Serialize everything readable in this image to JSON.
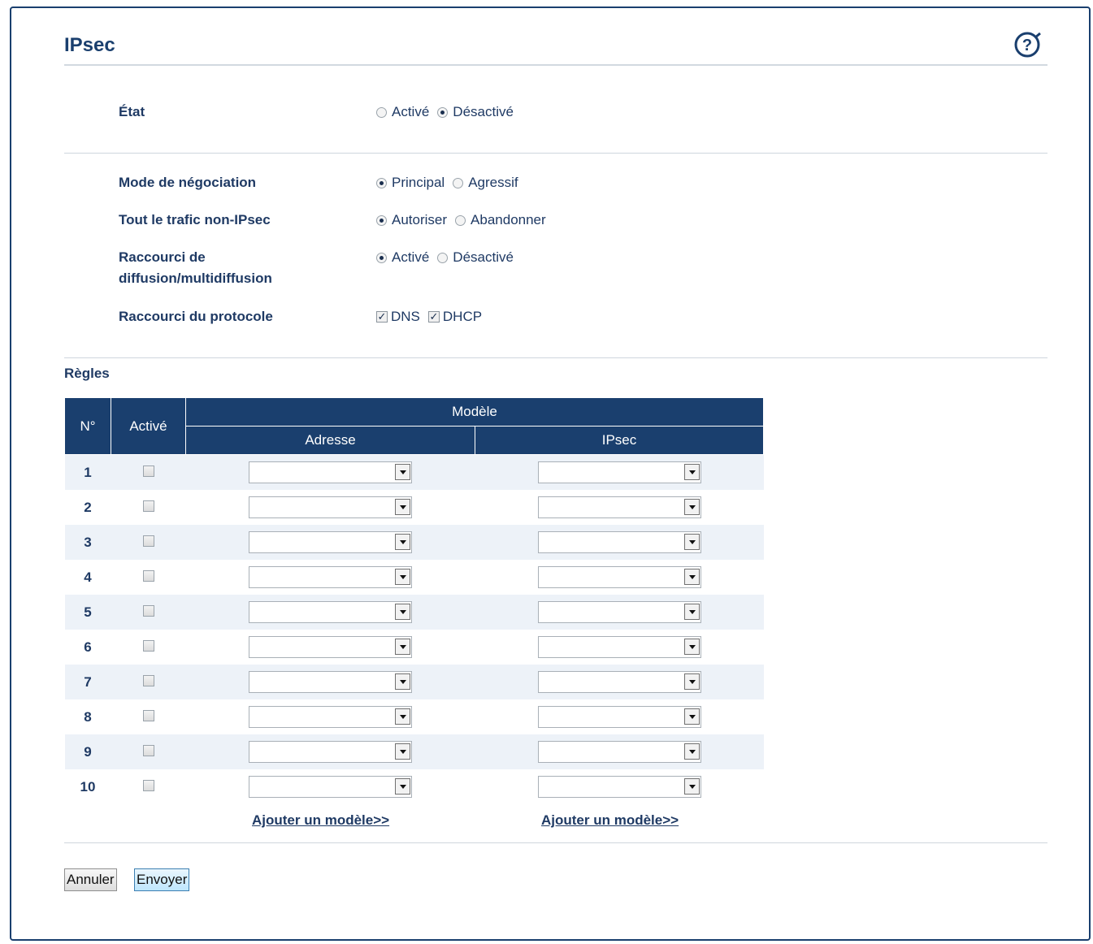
{
  "page": {
    "title": "IPsec"
  },
  "icons": {
    "help": "help-icon"
  },
  "status": {
    "label": "État",
    "options": [
      {
        "label": "Activé",
        "selected": false
      },
      {
        "label": "Désactivé",
        "selected": true
      }
    ]
  },
  "negotiation": {
    "label": "Mode de négociation",
    "options": [
      {
        "label": "Principal",
        "selected": true
      },
      {
        "label": "Agressif",
        "selected": false
      }
    ]
  },
  "traffic": {
    "label": "Tout le trafic non-IPsec",
    "options": [
      {
        "label": "Autoriser",
        "selected": true
      },
      {
        "label": "Abandonner",
        "selected": false
      }
    ]
  },
  "broadcast": {
    "label_line1": "Raccourci de",
    "label_line2": "diffusion/multidiffusion",
    "options": [
      {
        "label": "Activé",
        "selected": true
      },
      {
        "label": "Désactivé",
        "selected": false
      }
    ]
  },
  "protocol": {
    "label": "Raccourci du protocole",
    "options": [
      {
        "label": "DNS",
        "checked": true
      },
      {
        "label": "DHCP",
        "checked": true
      }
    ]
  },
  "rules": {
    "title": "Règles",
    "headers": {
      "num": "N°",
      "enabled": "Activé",
      "template": "Modèle",
      "address": "Adresse",
      "ipsec": "IPsec"
    },
    "rows": [
      {
        "num": "1",
        "enabled": false,
        "address": "",
        "ipsec": ""
      },
      {
        "num": "2",
        "enabled": false,
        "address": "",
        "ipsec": ""
      },
      {
        "num": "3",
        "enabled": false,
        "address": "",
        "ipsec": ""
      },
      {
        "num": "4",
        "enabled": false,
        "address": "",
        "ipsec": ""
      },
      {
        "num": "5",
        "enabled": false,
        "address": "",
        "ipsec": ""
      },
      {
        "num": "6",
        "enabled": false,
        "address": "",
        "ipsec": ""
      },
      {
        "num": "7",
        "enabled": false,
        "address": "",
        "ipsec": ""
      },
      {
        "num": "8",
        "enabled": false,
        "address": "",
        "ipsec": ""
      },
      {
        "num": "9",
        "enabled": false,
        "address": "",
        "ipsec": ""
      },
      {
        "num": "10",
        "enabled": false,
        "address": "",
        "ipsec": ""
      }
    ],
    "add_address_link": "Ajouter un modèle>>",
    "add_ipsec_link": "Ajouter un modèle>>"
  },
  "buttons": {
    "cancel": "Annuler",
    "submit": "Envoyer"
  },
  "colors": {
    "header": "#1a3f6e",
    "text": "#1f3a64",
    "row_alt": "#edf2f8"
  }
}
